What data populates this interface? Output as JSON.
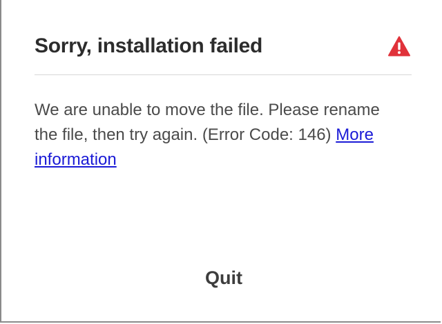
{
  "dialog": {
    "title": "Sorry, installation failed",
    "alert_icon": "alert-triangle-icon",
    "alert_color": "#e0323a",
    "message_text": "We are unable to move the file. Please rename the file, then try again. (Error Code: 146)",
    "link_text": "More information",
    "link_color": "#1a1ad6",
    "quit_label": "Quit"
  }
}
